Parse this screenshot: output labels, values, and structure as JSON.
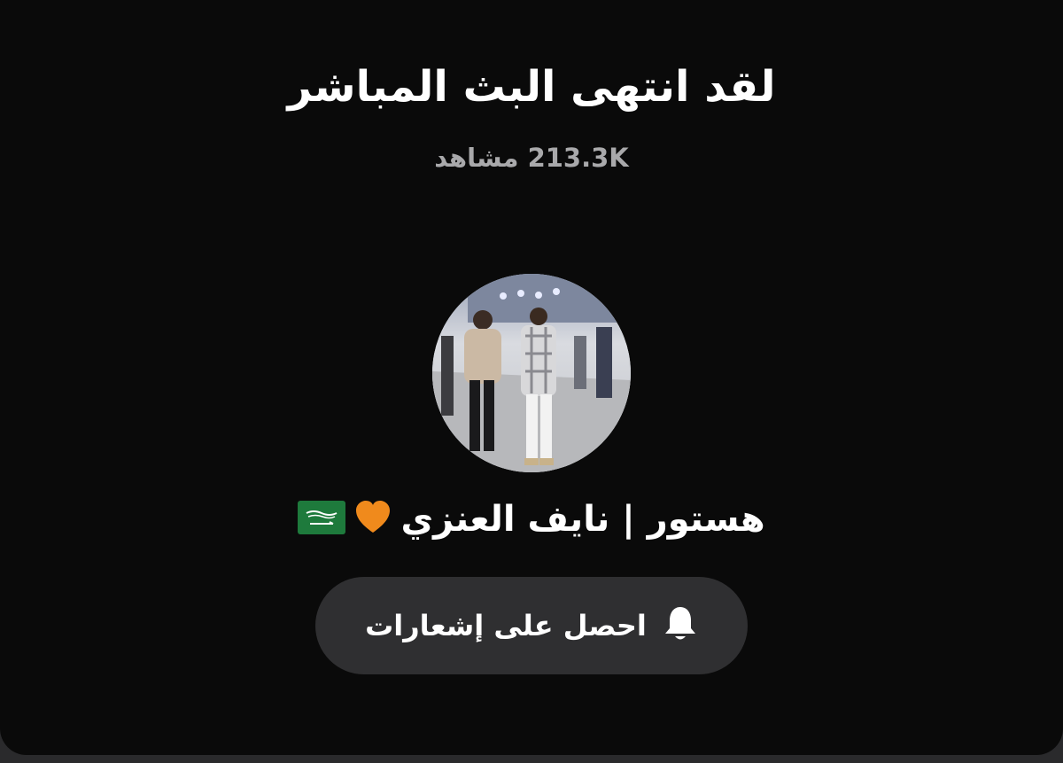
{
  "stream": {
    "title": "لقد انتهى البث المباشر",
    "viewer_count": "213.3K",
    "viewer_label": "مشاهد"
  },
  "host": {
    "name": "هستور | نايف العنزي",
    "emoji": [
      "orange-heart-icon",
      "saudi-flag-icon"
    ]
  },
  "notify": {
    "label": "احصل على إشعارات",
    "icon": "bell-icon"
  },
  "colors": {
    "background": "#0a0a0a",
    "button": "#2f2f31",
    "heart": "#f08a1c",
    "flag": "#1e7a3c"
  }
}
